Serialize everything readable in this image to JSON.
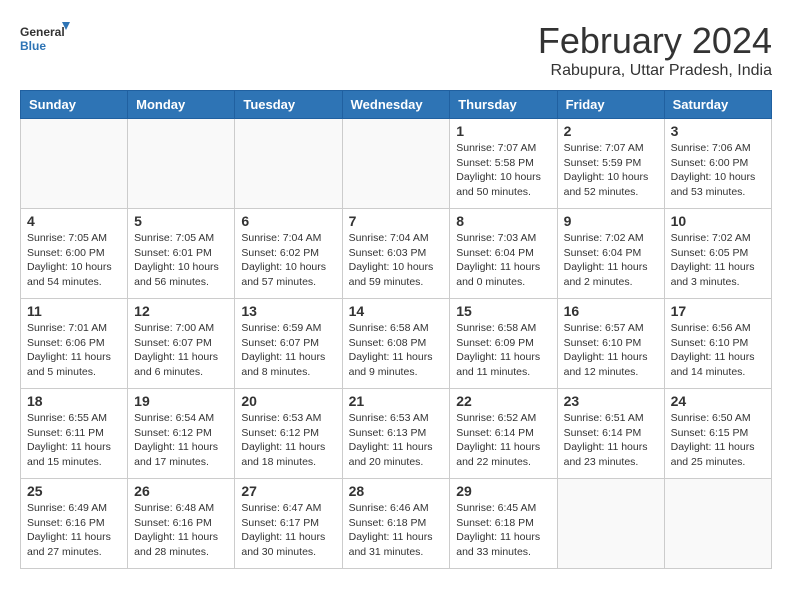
{
  "header": {
    "logo_line1": "General",
    "logo_line2": "Blue",
    "title": "February 2024",
    "subtitle": "Rabupura, Uttar Pradesh, India"
  },
  "days_of_week": [
    "Sunday",
    "Monday",
    "Tuesday",
    "Wednesday",
    "Thursday",
    "Friday",
    "Saturday"
  ],
  "weeks": [
    [
      {
        "day": "",
        "empty": true
      },
      {
        "day": "",
        "empty": true
      },
      {
        "day": "",
        "empty": true
      },
      {
        "day": "",
        "empty": true
      },
      {
        "day": "1",
        "sunrise": "7:07 AM",
        "sunset": "5:58 PM",
        "daylight": "10 hours and 50 minutes."
      },
      {
        "day": "2",
        "sunrise": "7:07 AM",
        "sunset": "5:59 PM",
        "daylight": "10 hours and 52 minutes."
      },
      {
        "day": "3",
        "sunrise": "7:06 AM",
        "sunset": "6:00 PM",
        "daylight": "10 hours and 53 minutes."
      }
    ],
    [
      {
        "day": "4",
        "sunrise": "7:05 AM",
        "sunset": "6:00 PM",
        "daylight": "10 hours and 54 minutes."
      },
      {
        "day": "5",
        "sunrise": "7:05 AM",
        "sunset": "6:01 PM",
        "daylight": "10 hours and 56 minutes."
      },
      {
        "day": "6",
        "sunrise": "7:04 AM",
        "sunset": "6:02 PM",
        "daylight": "10 hours and 57 minutes."
      },
      {
        "day": "7",
        "sunrise": "7:04 AM",
        "sunset": "6:03 PM",
        "daylight": "10 hours and 59 minutes."
      },
      {
        "day": "8",
        "sunrise": "7:03 AM",
        "sunset": "6:04 PM",
        "daylight": "11 hours and 0 minutes."
      },
      {
        "day": "9",
        "sunrise": "7:02 AM",
        "sunset": "6:04 PM",
        "daylight": "11 hours and 2 minutes."
      },
      {
        "day": "10",
        "sunrise": "7:02 AM",
        "sunset": "6:05 PM",
        "daylight": "11 hours and 3 minutes."
      }
    ],
    [
      {
        "day": "11",
        "sunrise": "7:01 AM",
        "sunset": "6:06 PM",
        "daylight": "11 hours and 5 minutes."
      },
      {
        "day": "12",
        "sunrise": "7:00 AM",
        "sunset": "6:07 PM",
        "daylight": "11 hours and 6 minutes."
      },
      {
        "day": "13",
        "sunrise": "6:59 AM",
        "sunset": "6:07 PM",
        "daylight": "11 hours and 8 minutes."
      },
      {
        "day": "14",
        "sunrise": "6:58 AM",
        "sunset": "6:08 PM",
        "daylight": "11 hours and 9 minutes."
      },
      {
        "day": "15",
        "sunrise": "6:58 AM",
        "sunset": "6:09 PM",
        "daylight": "11 hours and 11 minutes."
      },
      {
        "day": "16",
        "sunrise": "6:57 AM",
        "sunset": "6:10 PM",
        "daylight": "11 hours and 12 minutes."
      },
      {
        "day": "17",
        "sunrise": "6:56 AM",
        "sunset": "6:10 PM",
        "daylight": "11 hours and 14 minutes."
      }
    ],
    [
      {
        "day": "18",
        "sunrise": "6:55 AM",
        "sunset": "6:11 PM",
        "daylight": "11 hours and 15 minutes."
      },
      {
        "day": "19",
        "sunrise": "6:54 AM",
        "sunset": "6:12 PM",
        "daylight": "11 hours and 17 minutes."
      },
      {
        "day": "20",
        "sunrise": "6:53 AM",
        "sunset": "6:12 PM",
        "daylight": "11 hours and 18 minutes."
      },
      {
        "day": "21",
        "sunrise": "6:53 AM",
        "sunset": "6:13 PM",
        "daylight": "11 hours and 20 minutes."
      },
      {
        "day": "22",
        "sunrise": "6:52 AM",
        "sunset": "6:14 PM",
        "daylight": "11 hours and 22 minutes."
      },
      {
        "day": "23",
        "sunrise": "6:51 AM",
        "sunset": "6:14 PM",
        "daylight": "11 hours and 23 minutes."
      },
      {
        "day": "24",
        "sunrise": "6:50 AM",
        "sunset": "6:15 PM",
        "daylight": "11 hours and 25 minutes."
      }
    ],
    [
      {
        "day": "25",
        "sunrise": "6:49 AM",
        "sunset": "6:16 PM",
        "daylight": "11 hours and 27 minutes."
      },
      {
        "day": "26",
        "sunrise": "6:48 AM",
        "sunset": "6:16 PM",
        "daylight": "11 hours and 28 minutes."
      },
      {
        "day": "27",
        "sunrise": "6:47 AM",
        "sunset": "6:17 PM",
        "daylight": "11 hours and 30 minutes."
      },
      {
        "day": "28",
        "sunrise": "6:46 AM",
        "sunset": "6:18 PM",
        "daylight": "11 hours and 31 minutes."
      },
      {
        "day": "29",
        "sunrise": "6:45 AM",
        "sunset": "6:18 PM",
        "daylight": "11 hours and 33 minutes."
      },
      {
        "day": "",
        "empty": true
      },
      {
        "day": "",
        "empty": true
      }
    ]
  ],
  "labels": {
    "sunrise": "Sunrise:",
    "sunset": "Sunset:",
    "daylight": "Daylight:"
  }
}
